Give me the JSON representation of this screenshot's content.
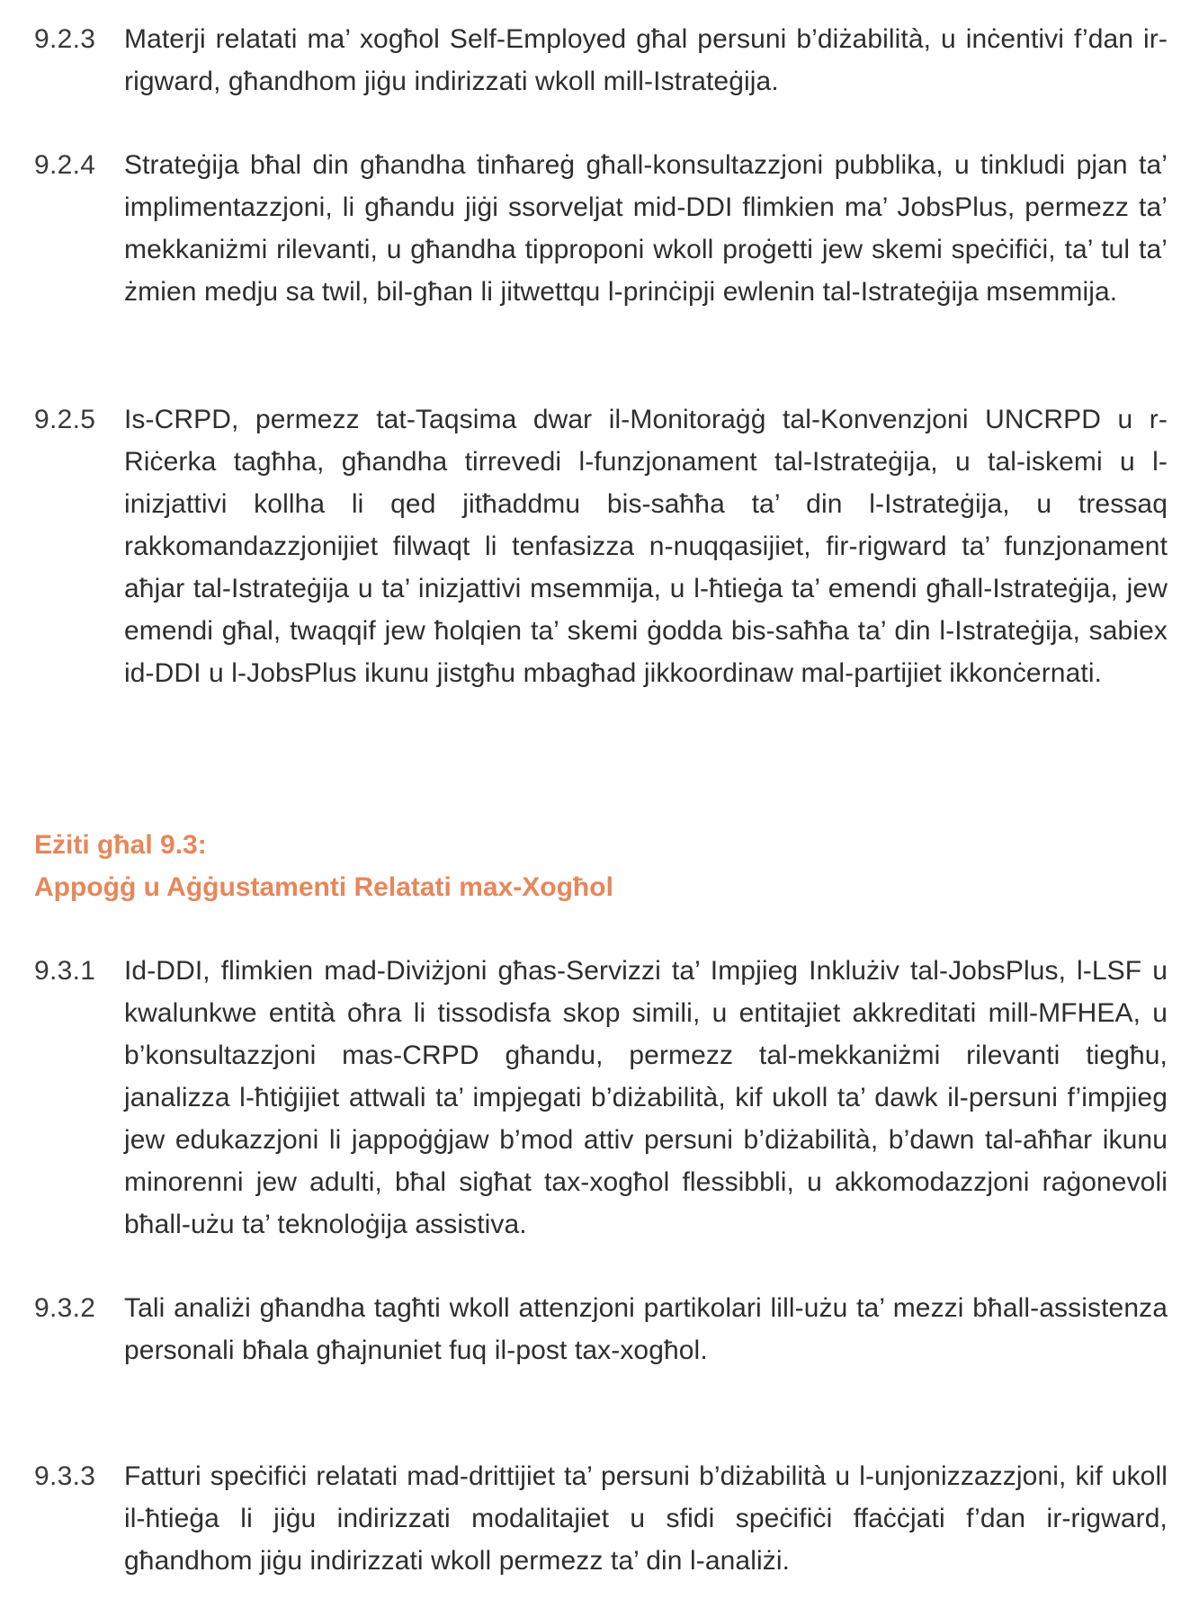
{
  "sections": {
    "s923": {
      "number": "9.2.3",
      "text": "Materji relatati ma’ xogħol Self-Employed għal persuni b’diżabilità, u inċentivi f’dan ir-rigward, għandhom jiġu indirizzati wkoll mill-Istrateġija."
    },
    "s924": {
      "number": "9.2.4",
      "text": "Strateġija bħal din għandha tinħareġ għall-konsultazzjoni pubblika, u tinkludi pjan ta’ implimentazzjoni, li għandu jiġi ssorveljat mid-DDI flimkien ma’ JobsPlus, permezz ta’ mekkaniżmi rilevanti, u għandha tipproponi wkoll proġetti jew skemi speċifiċi, ta’ tul ta’ żmien medju sa twil, bil-għan li jitwettqu l-prinċipji ewlenin tal-Istrateġija msemmija."
    },
    "s925": {
      "number": "9.2.5",
      "text": "Is-CRPD, permezz tat-Taqsima dwar il-Monitoraġġ tal-Konvenzjoni UNCRPD u r-Riċerka tagħha, għandha tirrevedi l-funzjonament tal-Istrateġija, u tal-iskemi u l-inizjattivi kollha li qed jitħaddmu bis-saħħa ta’ din l-Istrateġija, u tressaq rakkomandazzjonijiet filwaqt li tenfasizza n-nuqqasijiet, fir-rigward ta’ funzjonament aħjar tal-Istrateġija u ta’ inizjattivi msemmija, u l-ħtieġa ta’ emendi għall-Istrateġija, jew emendi għal, twaqqif jew ħolqien ta’ skemi ġodda bis-saħħa ta’ din l-Istrateġija, sabiex id-DDI u l-JobsPlus  ikunu jistgħu mbagħad jikkoordinaw mal-partijiet ikkonċernati."
    },
    "heading": {
      "line1": "Eżiti għal 9.3:",
      "line2": "Appoġġ u Aġġustamenti Relatati max-Xogħol"
    },
    "s931": {
      "number": "9.3.1",
      "text": "Id-DDI, flimkien mad-Diviżjoni għas-Servizzi ta’ Impjieg Inklużiv tal-JobsPlus, l-LSF u kwalunkwe entità oħra li tissodisfa skop simili,  u entitajiet akkreditati mill-MFHEA, u b’konsultazzjoni mas-CRPD għandu, permezz tal-mekkaniżmi rilevanti tiegħu, janalizza l-ħtiġijiet attwali ta’ impjegati b’diżabilità, kif ukoll ta’ dawk il-persuni f’impjieg  jew edukazzjoni li jappoġġjaw b’mod attiv persuni b’diżabilità, b’dawn tal-aħħar ikunu minorenni jew adulti, bħal sigħat tax-xogħol flessibbli, u akkomodazzjoni raġonevoli bħall-użu ta’ teknoloġija assistiva."
    },
    "s932": {
      "number": "9.3.2",
      "text": "Tali analiżi għandha tagħti wkoll attenzjoni partikolari lill-użu ta’ mezzi bħall-assistenza personali bħala għajnuniet fuq il-post tax-xogħol."
    },
    "s933": {
      "number": "9.3.3",
      "text": "Fatturi speċifiċi relatati mad-drittijiet ta’ persuni b’diżabilità u l-unjonizzazzjoni, kif ukoll il-ħtieġa li jiġu indirizzati modalitajiet u sfidi speċifiċi ffaċċjati f’dan ir-rigward, għandhom jiġu indirizzati wkoll permezz ta’ din l-analiżi."
    }
  }
}
